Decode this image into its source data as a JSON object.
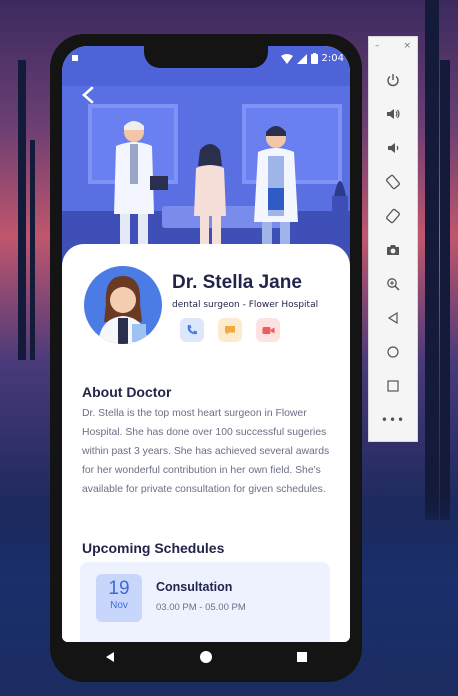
{
  "status_bar": {
    "time": "2:04"
  },
  "doctor": {
    "name": "Dr. Stella Jane",
    "subtitle": "dental surgeon - Flower Hospital"
  },
  "about": {
    "title": "About Doctor",
    "text": "Dr. Stella is the top most heart surgeon in Flower Hospital. She has done over 100 successful sugeries within past 3 years. She has achieved several awards for her wonderful contribution in her own field. She's available for private consultation for given schedules."
  },
  "schedules": {
    "title": "Upcoming Schedules",
    "items": [
      {
        "day": "19",
        "month": "Nov",
        "title": "Consultation",
        "time": "03.00 PM - 05.00 PM"
      }
    ]
  },
  "emulator": {
    "minimize": "–",
    "close": "×",
    "more": "•••"
  },
  "colors": {
    "accent": "#4b7be5",
    "hero": "#4f63d9",
    "text_dark": "#22254a",
    "text_muted": "#6b6f86",
    "call_bg": "#dde7fb",
    "chat_bg": "#fdebd0",
    "video_bg": "#fde2e2"
  },
  "icons": {
    "back": "back-arrow-icon",
    "call": "phone-icon",
    "chat": "chat-icon",
    "video": "video-camera-icon",
    "toolbar": [
      "power-icon",
      "volume-up-icon",
      "volume-down-icon",
      "rotate-left-icon",
      "rotate-right-icon",
      "camera-icon",
      "zoom-in-icon",
      "back-triangle-icon",
      "home-circle-icon",
      "overview-square-icon"
    ]
  }
}
